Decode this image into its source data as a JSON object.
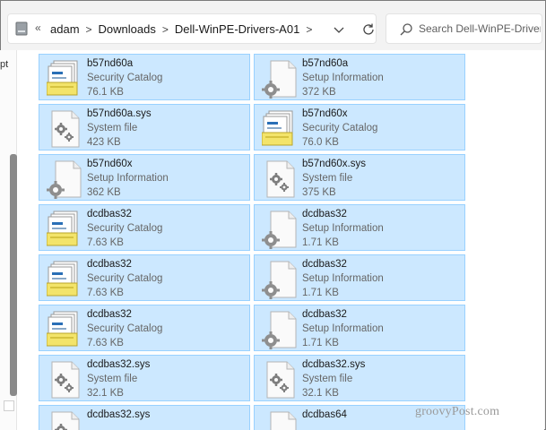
{
  "breadcrumbs": [
    "adam",
    "Downloads",
    "Dell-WinPE-Drivers-A01"
  ],
  "more_indicator": "«",
  "search": {
    "placeholder": "Search Dell-WinPE-Drivers-..."
  },
  "side_label": "pt",
  "files": [
    {
      "name": "b57nd60a",
      "type": "Security Catalog",
      "size": "76.1 KB",
      "icon": "catalog-icon"
    },
    {
      "name": "b57nd60a",
      "type": "Setup Information",
      "size": "372 KB",
      "icon": "setup-info-icon"
    },
    {
      "name": "b57nd60a.sys",
      "type": "System file",
      "size": "423 KB",
      "icon": "system-file-icon"
    },
    {
      "name": "b57nd60x",
      "type": "Security Catalog",
      "size": "76.0 KB",
      "icon": "catalog-icon"
    },
    {
      "name": "b57nd60x",
      "type": "Setup Information",
      "size": "362 KB",
      "icon": "setup-info-icon"
    },
    {
      "name": "b57nd60x.sys",
      "type": "System file",
      "size": "375 KB",
      "icon": "system-file-icon"
    },
    {
      "name": "dcdbas32",
      "type": "Security Catalog",
      "size": "7.63 KB",
      "icon": "catalog-icon"
    },
    {
      "name": "dcdbas32",
      "type": "Setup Information",
      "size": "1.71 KB",
      "icon": "setup-info-icon"
    },
    {
      "name": "dcdbas32",
      "type": "Security Catalog",
      "size": "7.63 KB",
      "icon": "catalog-icon"
    },
    {
      "name": "dcdbas32",
      "type": "Setup Information",
      "size": "1.71 KB",
      "icon": "setup-info-icon"
    },
    {
      "name": "dcdbas32",
      "type": "Security Catalog",
      "size": "7.63 KB",
      "icon": "catalog-icon"
    },
    {
      "name": "dcdbas32",
      "type": "Setup Information",
      "size": "1.71 KB",
      "icon": "setup-info-icon"
    },
    {
      "name": "dcdbas32.sys",
      "type": "System file",
      "size": "32.1 KB",
      "icon": "system-file-icon"
    },
    {
      "name": "dcdbas32.sys",
      "type": "System file",
      "size": "32.1 KB",
      "icon": "system-file-icon"
    },
    {
      "name": "dcdbas32.sys",
      "type": "",
      "size": "",
      "icon": "system-file-icon"
    },
    {
      "name": "dcdbas64",
      "type": "",
      "size": "",
      "icon": "setup-info-icon"
    }
  ],
  "watermark": "groovyPost.com",
  "colors": {
    "selection": "#cce8ff",
    "selection_border": "#99d1ff"
  }
}
